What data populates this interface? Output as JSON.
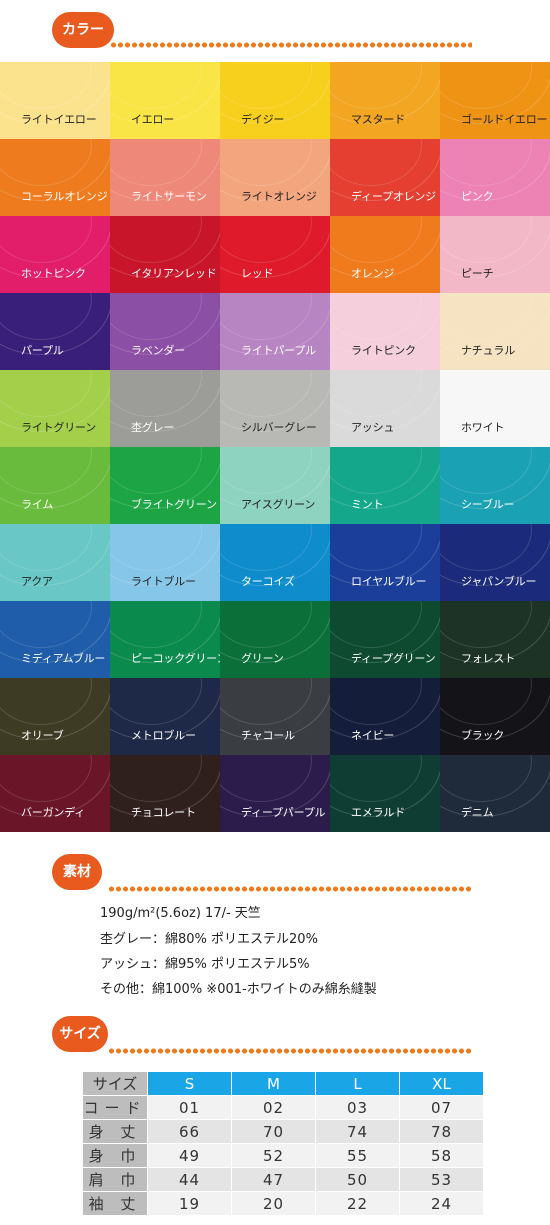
{
  "sections": {
    "color_title": "カラー",
    "material_title": "素材",
    "size_title": "サイズ"
  },
  "colors": [
    {
      "label": "ライトイエロー",
      "bg": "#fbe38e",
      "text": "#222"
    },
    {
      "label": "イエロー",
      "bg": "#f9e546",
      "text": "#222"
    },
    {
      "label": "デイジー",
      "bg": "#f7cf1d",
      "text": "#222"
    },
    {
      "label": "マスタード",
      "bg": "#f2a621",
      "text": "#222"
    },
    {
      "label": "ゴールドイエロー",
      "bg": "#ee9314",
      "text": "#222"
    },
    {
      "label": "コーラルオレンジ",
      "bg": "#ee7c1f",
      "text": "#fff"
    },
    {
      "label": "ライトサーモン",
      "bg": "#ee8878",
      "text": "#fff"
    },
    {
      "label": "ライトオレンジ",
      "bg": "#f3a67e",
      "text": "#222"
    },
    {
      "label": "ディープオレンジ",
      "bg": "#e43f30",
      "text": "#fff"
    },
    {
      "label": "ピンク",
      "bg": "#ed82b5",
      "text": "#fff"
    },
    {
      "label": "ホットピンク",
      "bg": "#e21d6a",
      "text": "#fff"
    },
    {
      "label": "イタリアンレッド",
      "bg": "#c8152a",
      "text": "#fff"
    },
    {
      "label": "レッド",
      "bg": "#df1a2b",
      "text": "#fff"
    },
    {
      "label": "オレンジ",
      "bg": "#ef7b1d",
      "text": "#fff"
    },
    {
      "label": "ピーチ",
      "bg": "#f3b8c7",
      "text": "#222"
    },
    {
      "label": "パープル",
      "bg": "#3a1f7a",
      "text": "#fff"
    },
    {
      "label": "ラベンダー",
      "bg": "#8b4fa5",
      "text": "#fff"
    },
    {
      "label": "ライトパープル",
      "bg": "#b785c2",
      "text": "#fff"
    },
    {
      "label": "ライトピンク",
      "bg": "#f5cfdc",
      "text": "#222"
    },
    {
      "label": "ナチュラル",
      "bg": "#f5e3c2",
      "text": "#222"
    },
    {
      "label": "ライトグリーン",
      "bg": "#a3cf4a",
      "text": "#222"
    },
    {
      "label": "杢グレー",
      "bg": "#9c9c98",
      "text": "#fff"
    },
    {
      "label": "シルバーグレー",
      "bg": "#b8b8b4",
      "text": "#222"
    },
    {
      "label": "アッシュ",
      "bg": "#dadada",
      "text": "#222"
    },
    {
      "label": "ホワイト",
      "bg": "#f7f7f7",
      "text": "#222"
    },
    {
      "label": "ライム",
      "bg": "#69bb3d",
      "text": "#fff"
    },
    {
      "label": "ブライトグリーン",
      "bg": "#1da545",
      "text": "#fff"
    },
    {
      "label": "アイスグリーン",
      "bg": "#8ed3c0",
      "text": "#222"
    },
    {
      "label": "ミント",
      "bg": "#15a78b",
      "text": "#fff"
    },
    {
      "label": "シーブルー",
      "bg": "#1ba1b4",
      "text": "#fff"
    },
    {
      "label": "アクア",
      "bg": "#69c7c6",
      "text": "#222"
    },
    {
      "label": "ライトブルー",
      "bg": "#86c6e8",
      "text": "#222"
    },
    {
      "label": "ターコイズ",
      "bg": "#0e8ccb",
      "text": "#fff"
    },
    {
      "label": "ロイヤルブルー",
      "bg": "#1a3e9a",
      "text": "#fff"
    },
    {
      "label": "ジャパンブルー",
      "bg": "#1b2a7a",
      "text": "#fff"
    },
    {
      "label": "ミディアムブルー",
      "bg": "#1f5ca9",
      "text": "#fff"
    },
    {
      "label": "ピーコックグリーン",
      "bg": "#0b8a4e",
      "text": "#fff"
    },
    {
      "label": "グリーン",
      "bg": "#0b6f3a",
      "text": "#fff"
    },
    {
      "label": "ディープグリーン",
      "bg": "#0d4a30",
      "text": "#fff"
    },
    {
      "label": "フォレスト",
      "bg": "#1c3326",
      "text": "#fff"
    },
    {
      "label": "オリーブ",
      "bg": "#3e3b25",
      "text": "#fff"
    },
    {
      "label": "メトロブルー",
      "bg": "#1d2947",
      "text": "#fff"
    },
    {
      "label": "チャコール",
      "bg": "#3a3d42",
      "text": "#fff"
    },
    {
      "label": "ネイビー",
      "bg": "#141e3a",
      "text": "#fff"
    },
    {
      "label": "ブラック",
      "bg": "#141418",
      "text": "#fff"
    },
    {
      "label": "バーガンディ",
      "bg": "#6a1528",
      "text": "#fff"
    },
    {
      "label": "チョコレート",
      "bg": "#2f1f1d",
      "text": "#fff"
    },
    {
      "label": "ディープパープル",
      "bg": "#2b1c4c",
      "text": "#fff"
    },
    {
      "label": "エメラルド",
      "bg": "#0f3d33",
      "text": "#fff"
    },
    {
      "label": "デニム",
      "bg": "#1f2a3a",
      "text": "#fff"
    }
  ],
  "material": [
    "190g/m²(5.6oz) 17/- 天竺",
    "杢グレー：綿80% ポリエステル20%",
    "アッシュ：綿95% ポリエステル5%",
    "その他：綿100% ※001-ホワイトのみ綿糸縫製"
  ],
  "size_table": {
    "corner": "サイズ",
    "sizes": [
      "S",
      "M",
      "L",
      "XL"
    ],
    "rows": [
      {
        "label": "コード",
        "values": [
          "01",
          "02",
          "03",
          "07"
        ]
      },
      {
        "label": "身 丈",
        "values": [
          "66",
          "70",
          "74",
          "78"
        ]
      },
      {
        "label": "身 巾",
        "values": [
          "49",
          "52",
          "55",
          "58"
        ]
      },
      {
        "label": "肩 巾",
        "values": [
          "44",
          "47",
          "50",
          "53"
        ]
      },
      {
        "label": "袖 丈",
        "values": [
          "19",
          "20",
          "22",
          "24"
        ]
      }
    ]
  }
}
